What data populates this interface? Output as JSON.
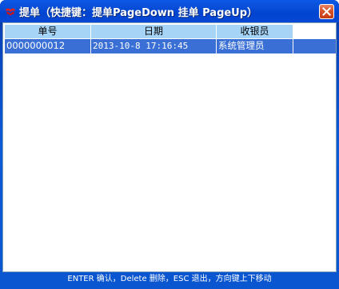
{
  "window": {
    "title": "提单（快捷键：提单PageDown 挂单 PageUp）"
  },
  "grid": {
    "columns": [
      "单号",
      "日期",
      "收银员"
    ],
    "rows": [
      {
        "order_no": "0000000012",
        "date": "2013-10-8 17:16:45",
        "cashier": "系统管理员"
      }
    ],
    "selected_row_color": "#3a70d6",
    "header_color": "#a6d4f7"
  },
  "statusbar": {
    "hint": "ENTER 确认，Delete 删除，ESC 退出，方向键上下移动"
  },
  "icons": {
    "app": "app-logo-icon",
    "close": "close-icon"
  }
}
